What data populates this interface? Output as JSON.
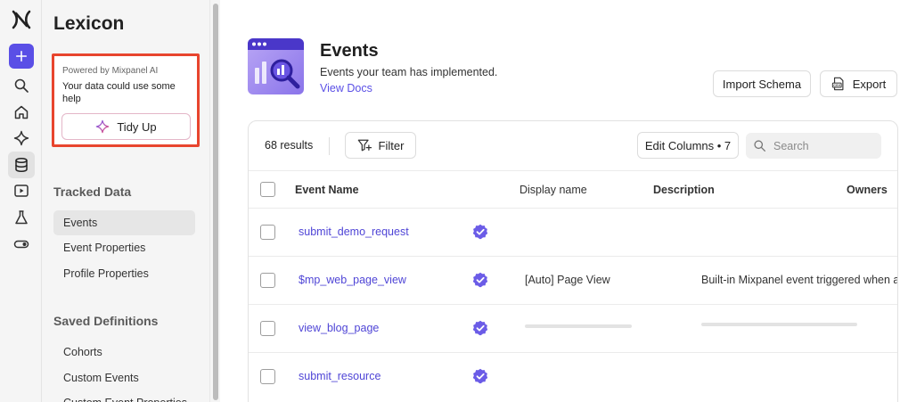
{
  "sidebar": {
    "title": "Lexicon",
    "ai_box": {
      "powered_by": "Powered by Mixpanel AI",
      "message": "Your data could use some help",
      "button_label": "Tidy Up"
    },
    "sections": [
      {
        "title": "Tracked Data",
        "items": [
          "Events",
          "Event Properties",
          "Profile Properties"
        ]
      },
      {
        "title": "Saved Definitions",
        "items": [
          "Cohorts",
          "Custom Events",
          "Custom Event Properties"
        ]
      }
    ],
    "active_item": "Events"
  },
  "rail": {
    "icons": [
      "mixpanel-logo-icon",
      "plus-icon",
      "search-icon",
      "home-icon",
      "sparkle-icon",
      "database-icon",
      "session-replay-icon",
      "flask-icon",
      "toggle-icon"
    ]
  },
  "header": {
    "title": "Events",
    "subtitle": "Events your team has implemented.",
    "link": "View Docs",
    "import_label": "Import Schema",
    "export_label": "Export"
  },
  "toolbar": {
    "results": "68 results",
    "filter_label": "Filter",
    "edit_columns_label": "Edit Columns • 7",
    "search_placeholder": "Search"
  },
  "table": {
    "columns": [
      "Event Name",
      "Display name",
      "Description",
      "Owners"
    ],
    "rows": [
      {
        "name": "submit_demo_request",
        "verified": true,
        "display_name": "",
        "description": ""
      },
      {
        "name": "$mp_web_page_view",
        "verified": true,
        "display_name": "[Auto] Page View",
        "description": "Built-in Mixpanel event triggered when a"
      },
      {
        "name": "view_blog_page",
        "verified": true,
        "display_name": "",
        "description": ""
      },
      {
        "name": "submit_resource",
        "verified": true,
        "display_name": "",
        "description": ""
      }
    ]
  },
  "colors": {
    "accent": "#5a4fe6",
    "highlight_border": "#e8452e",
    "link": "#4f45d6"
  }
}
